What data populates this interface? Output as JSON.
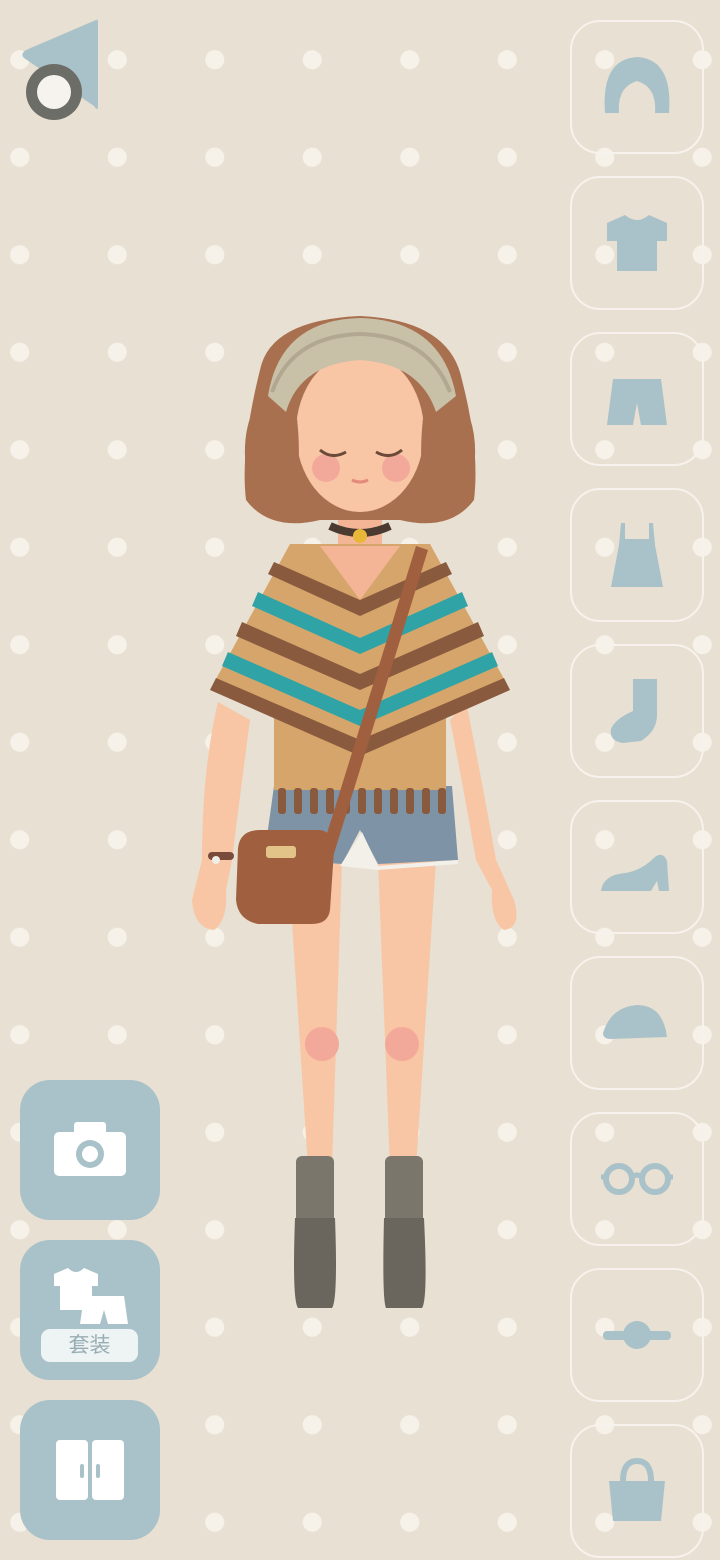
{
  "theme": {
    "background": "#e8e0d2",
    "icon_color": "#a9c2c9",
    "button_fill": "#a9c2c9"
  },
  "top_left": {
    "icon": "back-triangle-icon"
  },
  "category_buttons": [
    {
      "name": "hair",
      "icon": "hair-icon"
    },
    {
      "name": "top",
      "icon": "tshirt-icon"
    },
    {
      "name": "bottom",
      "icon": "shorts-icon"
    },
    {
      "name": "dress",
      "icon": "dress-icon"
    },
    {
      "name": "socks",
      "icon": "sock-icon"
    },
    {
      "name": "shoes",
      "icon": "heel-shoe-icon"
    },
    {
      "name": "hat",
      "icon": "cap-icon"
    },
    {
      "name": "glasses",
      "icon": "glasses-icon"
    },
    {
      "name": "accessory",
      "icon": "choker-icon"
    },
    {
      "name": "bag",
      "icon": "handbag-icon"
    }
  ],
  "left_buttons": {
    "camera": {
      "icon": "camera-icon"
    },
    "outfit": {
      "icon": "outfit-icon",
      "label": "套装"
    },
    "wardrobe": {
      "icon": "wardrobe-icon"
    }
  }
}
